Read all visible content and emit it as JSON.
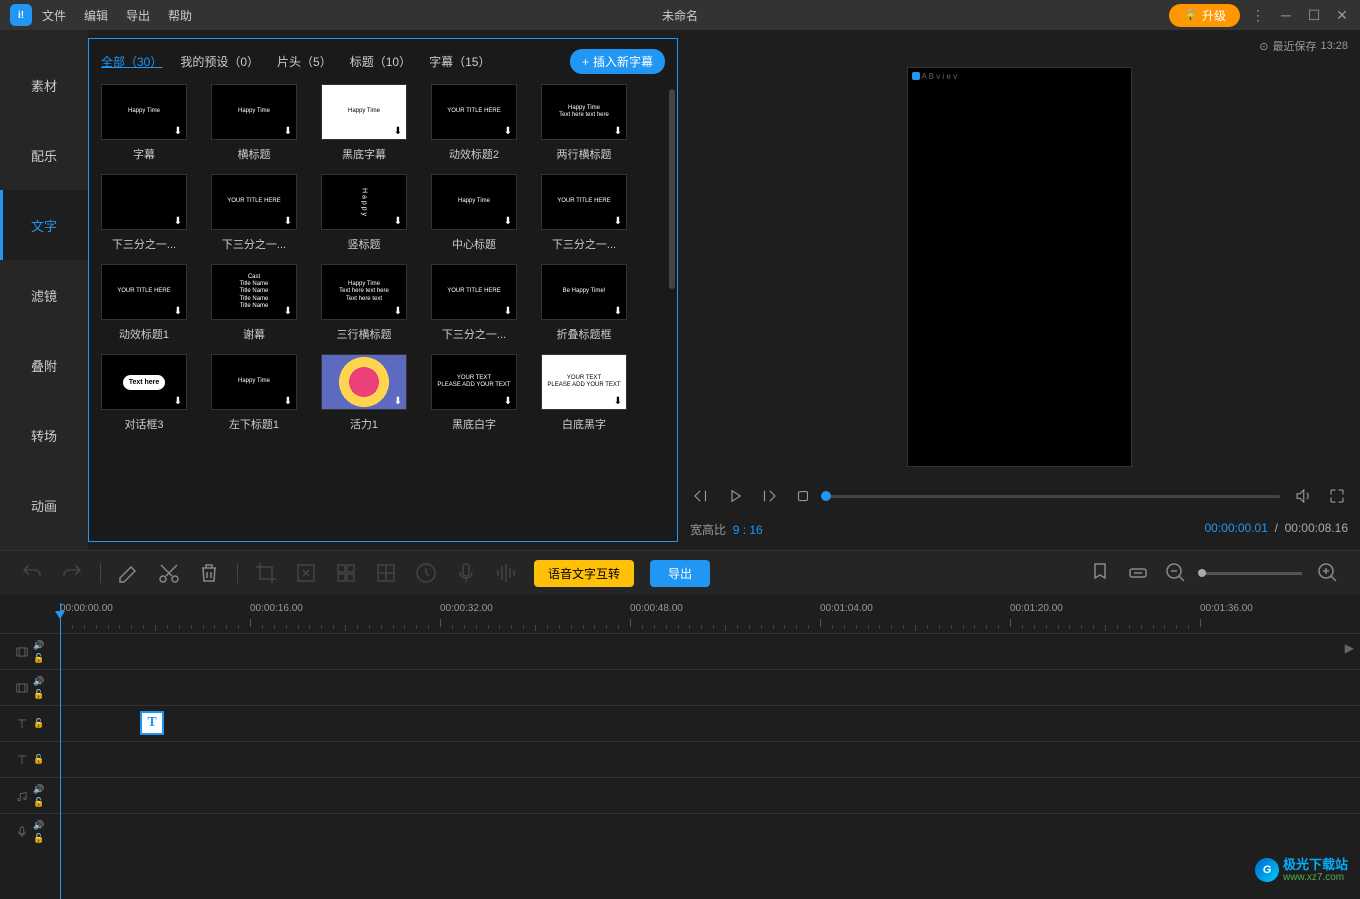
{
  "titlebar": {
    "menus": [
      "文件",
      "编辑",
      "导出",
      "帮助"
    ],
    "title": "未命名",
    "upgrade": "升级",
    "save_label": "最近保存",
    "save_time": "13:28"
  },
  "sidebar": {
    "items": [
      {
        "label": "素材"
      },
      {
        "label": "配乐"
      },
      {
        "label": "文字",
        "active": true
      },
      {
        "label": "滤镜"
      },
      {
        "label": "叠附"
      },
      {
        "label": "转场"
      },
      {
        "label": "动画"
      }
    ]
  },
  "library": {
    "tabs": [
      {
        "label": "全部（30）",
        "active": true
      },
      {
        "label": "我的预设（0）"
      },
      {
        "label": "片头（5）"
      },
      {
        "label": "标题（10）"
      },
      {
        "label": "字幕（15）"
      }
    ],
    "insert_label": "插入新字幕",
    "items": [
      [
        {
          "label": "字幕",
          "preview": "Happy Time"
        },
        {
          "label": "横标题",
          "preview": "Happy Time"
        },
        {
          "label": "黑底字幕",
          "preview": "Happy Time",
          "white": true
        },
        {
          "label": "动效标题2",
          "preview": "YOUR TITLE HERE"
        },
        {
          "label": "两行横标题",
          "preview": "Happy Time\nText here text here"
        }
      ],
      [
        {
          "label": "下三分之一...",
          "preview": ""
        },
        {
          "label": "下三分之一...",
          "preview": "YOUR TITLE HERE"
        },
        {
          "label": "竖标题",
          "preview": "Happy",
          "vertical": true
        },
        {
          "label": "中心标题",
          "preview": "Happy Time"
        },
        {
          "label": "下三分之一...",
          "preview": "YOUR TITLE HERE"
        }
      ],
      [
        {
          "label": "动效标题1",
          "preview": "YOUR TITLE HERE"
        },
        {
          "label": "谢幕",
          "preview": "Cast\nTitle Name\nTitle Name\nTitle Name\nTitle Name"
        },
        {
          "label": "三行横标题",
          "preview": "Happy Time\nText here text here\nText here text"
        },
        {
          "label": "下三分之一...",
          "preview": "YOUR TITLE HERE"
        },
        {
          "label": "折叠标题框",
          "preview": "Be Happy Time!"
        }
      ],
      [
        {
          "label": "对话框3",
          "preview": "Text here",
          "cloud": true
        },
        {
          "label": "左下标题1",
          "preview": "Happy Time"
        },
        {
          "label": "活力1",
          "preview": "",
          "colorful": true
        },
        {
          "label": "黑底白字",
          "preview": "YOUR TEXT\nPLEASE ADD YOUR TEXT"
        },
        {
          "label": "白底黑字",
          "preview": "YOUR TEXT\nPLEASE ADD YOUR TEXT",
          "white": true
        }
      ]
    ]
  },
  "preview": {
    "aspect_label": "宽高比",
    "aspect_value": "9 : 16",
    "current_time": "00:00:00.01",
    "total_time": "00:00:08.16",
    "watermark": "A B v i e v"
  },
  "toolbar": {
    "voice_btn": "语音文字互转",
    "export_btn": "导出"
  },
  "timeline": {
    "marks": [
      "00:00:00.00",
      "00:00:16.00",
      "00:00:32.00",
      "00:00:48.00",
      "00:01:04.00",
      "00:01:20.00",
      "00:01:36.00"
    ],
    "clip_letter": "T"
  },
  "watermark": {
    "main": "极光下载站",
    "sub": "www.xz7.com"
  }
}
